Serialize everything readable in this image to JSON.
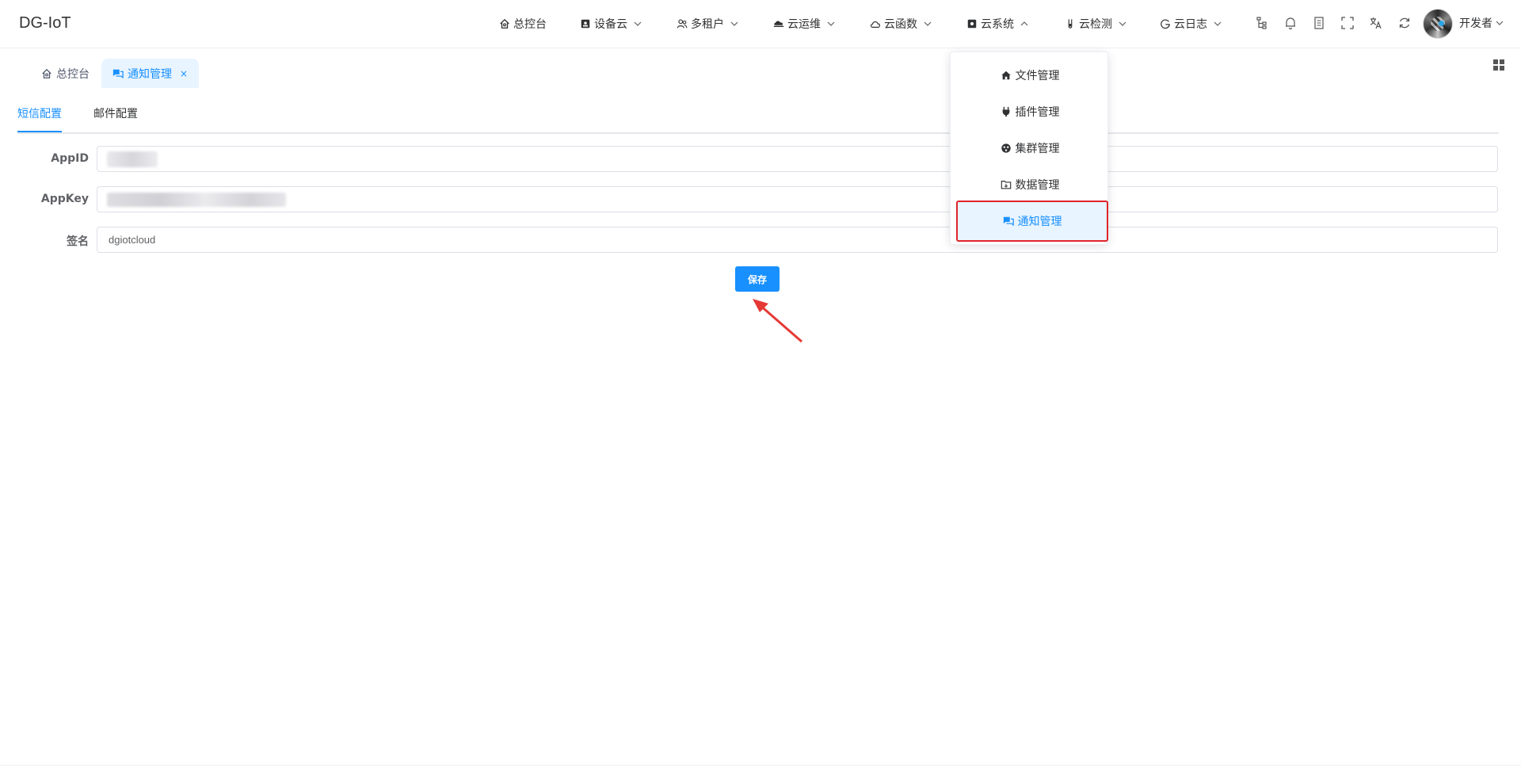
{
  "app": {
    "title": "DG-IoT"
  },
  "nav": {
    "items": [
      {
        "label": "总控台",
        "icon": "home-icon",
        "has_dropdown": false
      },
      {
        "label": "设备云",
        "icon": "device-icon",
        "has_dropdown": true
      },
      {
        "label": "多租户",
        "icon": "users-icon",
        "has_dropdown": true
      },
      {
        "label": "云运维",
        "icon": "cloud-ops-icon",
        "has_dropdown": true
      },
      {
        "label": "云函数",
        "icon": "cloud-icon",
        "has_dropdown": true
      },
      {
        "label": "云系统",
        "icon": "system-icon",
        "has_dropdown": true,
        "expanded": true
      },
      {
        "label": "云检测",
        "icon": "test-tube-icon",
        "has_dropdown": true
      },
      {
        "label": "云日志",
        "icon": "log-icon",
        "has_dropdown": true
      }
    ],
    "tools": [
      "sitemap-icon",
      "bell-icon",
      "doc-icon",
      "fullscreen-icon",
      "translate-icon",
      "refresh-icon"
    ],
    "user": {
      "name": "开发者"
    }
  },
  "tabs": {
    "items": [
      {
        "label": "总控台",
        "icon": "home-icon",
        "active": false
      },
      {
        "label": "通知管理",
        "icon": "chat-icon",
        "active": true,
        "close": "×"
      }
    ]
  },
  "subtabs": {
    "items": [
      {
        "label": "短信配置",
        "active": true
      },
      {
        "label": "邮件配置",
        "active": false
      }
    ]
  },
  "form": {
    "appid_label": "AppID",
    "appkey_label": "AppKey",
    "sign_label": "签名",
    "sign_value": "dgiotcloud",
    "save_label": "保存"
  },
  "dropdown": {
    "items": [
      {
        "label": "文件管理",
        "icon": "house-icon"
      },
      {
        "label": "插件管理",
        "icon": "plug-icon"
      },
      {
        "label": "集群管理",
        "icon": "cluster-icon"
      },
      {
        "label": "数据管理",
        "icon": "folder-icon"
      },
      {
        "label": "通知管理",
        "icon": "chat-icon",
        "active": true
      }
    ]
  },
  "colors": {
    "primary": "#1890ff",
    "highlight_border": "#e0242a",
    "annotation_arrow": "#e53935"
  }
}
